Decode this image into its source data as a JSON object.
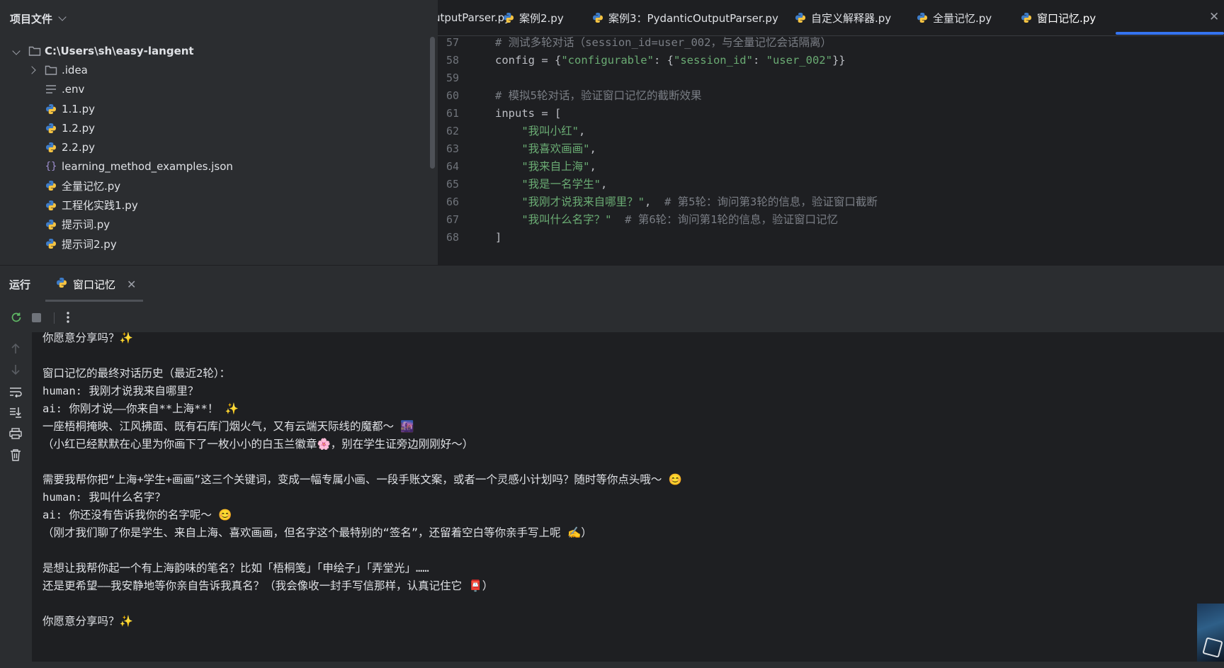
{
  "project": {
    "header": "项目文件",
    "root": "C:\\Users\\sh\\easy-langent",
    "items": [
      {
        "label": ".idea",
        "type": "folder"
      },
      {
        "label": ".env",
        "type": "text"
      },
      {
        "label": "1.1.py",
        "type": "python"
      },
      {
        "label": "1.2.py",
        "type": "python"
      },
      {
        "label": "2.2.py",
        "type": "python"
      },
      {
        "label": "learning_method_examples.json",
        "type": "json"
      },
      {
        "label": "全量记忆.py",
        "type": "python"
      },
      {
        "label": "工程化实践1.py",
        "type": "python"
      },
      {
        "label": "提示词.py",
        "type": "python"
      },
      {
        "label": "提示词2.py",
        "type": "python"
      }
    ]
  },
  "tabs": [
    {
      "label": "utputParser.py",
      "active": false
    },
    {
      "label": "案例2.py",
      "active": false
    },
    {
      "label": "案例3：PydanticOutputParser.py",
      "active": false
    },
    {
      "label": "自定义解释器.py",
      "active": false
    },
    {
      "label": "全量记忆.py",
      "active": false
    },
    {
      "label": "窗口记忆.py",
      "active": true
    }
  ],
  "editor": {
    "lines": [
      {
        "n": "57",
        "segs": [
          {
            "t": "# 测试多轮对话（session_id=user_002，与全量记忆会话隔离）",
            "c": "comment"
          }
        ]
      },
      {
        "n": "58",
        "segs": [
          {
            "t": "config = {",
            "c": "plain"
          },
          {
            "t": "\"configurable\"",
            "c": "str"
          },
          {
            "t": ": {",
            "c": "plain"
          },
          {
            "t": "\"session_id\"",
            "c": "str"
          },
          {
            "t": ": ",
            "c": "plain"
          },
          {
            "t": "\"user_002\"",
            "c": "str"
          },
          {
            "t": "}}",
            "c": "plain"
          }
        ]
      },
      {
        "n": "59",
        "segs": []
      },
      {
        "n": "60",
        "segs": [
          {
            "t": "# 模拟5轮对话，验证窗口记忆的截断效果",
            "c": "comment"
          }
        ]
      },
      {
        "n": "61",
        "segs": [
          {
            "t": "inputs = [",
            "c": "plain"
          }
        ]
      },
      {
        "n": "62",
        "segs": [
          {
            "t": "    ",
            "c": "plain"
          },
          {
            "t": "\"我叫小红\"",
            "c": "str"
          },
          {
            "t": ",",
            "c": "plain"
          }
        ]
      },
      {
        "n": "63",
        "segs": [
          {
            "t": "    ",
            "c": "plain"
          },
          {
            "t": "\"我喜欢画画\"",
            "c": "str"
          },
          {
            "t": ",",
            "c": "plain"
          }
        ]
      },
      {
        "n": "64",
        "segs": [
          {
            "t": "    ",
            "c": "plain"
          },
          {
            "t": "\"我来自上海\"",
            "c": "str"
          },
          {
            "t": ",",
            "c": "plain"
          }
        ]
      },
      {
        "n": "65",
        "segs": [
          {
            "t": "    ",
            "c": "plain"
          },
          {
            "t": "\"我是一名学生\"",
            "c": "str"
          },
          {
            "t": ",",
            "c": "plain"
          }
        ]
      },
      {
        "n": "66",
        "segs": [
          {
            "t": "    ",
            "c": "plain"
          },
          {
            "t": "\"我刚才说我来自哪里？\"",
            "c": "str"
          },
          {
            "t": ",  ",
            "c": "plain"
          },
          {
            "t": "# 第5轮：询问第3轮的信息，验证窗口截断",
            "c": "comment"
          }
        ]
      },
      {
        "n": "67",
        "segs": [
          {
            "t": "    ",
            "c": "plain"
          },
          {
            "t": "\"我叫什么名字？\"",
            "c": "str"
          },
          {
            "t": "  ",
            "c": "plain"
          },
          {
            "t": "# 第6轮：询问第1轮的信息，验证窗口记忆",
            "c": "comment"
          }
        ]
      },
      {
        "n": "68",
        "segs": [
          {
            "t": "]",
            "c": "plain"
          }
        ]
      }
    ]
  },
  "run": {
    "title": "运行",
    "tab_label": "窗口记忆",
    "console": [
      "你愿意分享吗？✨",
      "",
      "窗口记忆的最终对话历史（最近2轮）：",
      "human: 我刚才说我来自哪里？",
      "ai: 你刚才说——你来自**上海**！ ✨",
      "一座梧桐掩映、江风拂面、既有石库门烟火气，又有云端天际线的魔都～ 🌆",
      "（小红已经默默在心里为你画下了一枚小小的白玉兰徽章🌸，别在学生证旁边刚刚好～）",
      "",
      "需要我帮你把“上海+学生+画画”这三个关键词，变成一幅专属小画、一段手账文案，或者一个灵感小计划吗？随时等你点头哦～ 😊",
      "human: 我叫什么名字？",
      "ai: 你还没有告诉我你的名字呢～ 😊",
      "（刚才我们聊了你是学生、来自上海、喜欢画画，但名字这个最特别的“签名”，还留着空白等你亲手写上呢 ✍️）",
      "",
      "是想让我帮你起一个有上海韵味的笔名？比如「梧桐笺」「申绘子」「弄堂光」……",
      "还是更希望——我安静地等你亲自告诉我真名？（我会像收一封手写信那样，认真记住它 📮）",
      "",
      "你愿意分享吗？✨"
    ]
  },
  "colors": {
    "accent": "#3574f0",
    "string": "#6aab73",
    "comment": "#7a7e85",
    "panel": "#2b2d30",
    "editor_bg": "#1e1f22"
  }
}
